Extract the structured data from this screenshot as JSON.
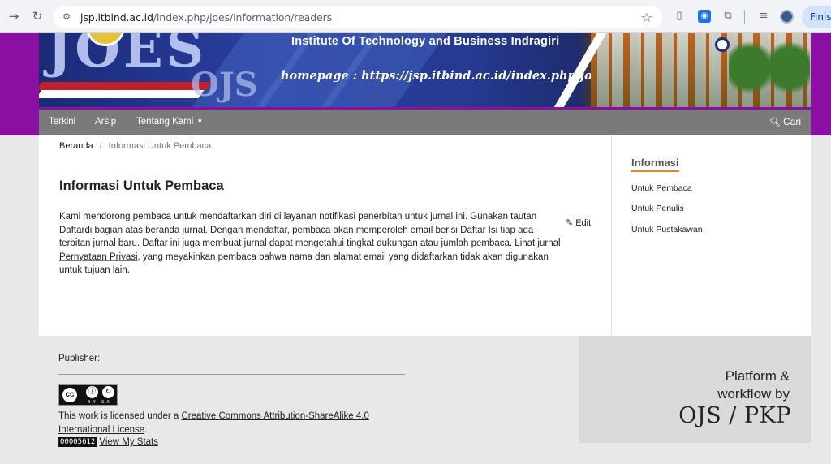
{
  "browser": {
    "url_domain": "jsp.itbind.ac.id",
    "url_path": "/index.php/joes/information/readers",
    "finish_label": "Finish"
  },
  "banner": {
    "institute": "Institute Of  Technology and  Business Indragiri",
    "homepage": "homepage : https://jsp.itbind.ac.id/index.php/joes",
    "logo_text": "JOES",
    "ojs_text": "OJS"
  },
  "nav": {
    "items": [
      "Terkini",
      "Arsip",
      "Tentang Kami"
    ],
    "search_label": "Cari"
  },
  "breadcrumb": {
    "home": "Beranda",
    "separator": "/",
    "current": "Informasi Untuk Pembaca"
  },
  "main": {
    "title": "Informasi Untuk Pembaca",
    "edit_label": "Edit",
    "para_1": "Kami mendorong pembaca untuk mendaftarkan diri di layanan notifikasi penerbitan untuk jurnal ini. Gunakan tautan ",
    "link_daftar": "Daftar",
    "para_2": "di bagian atas beranda jurnal. Dengan mendaftar, pembaca akan memperoleh email berisi Daftar Isi tiap ada terbitan jurnal baru. Daftar ini juga membuat jurnal dapat mengetahui tingkat dukungan atau jumlah pembaca. Lihat jurnal ",
    "link_privacy": "Pernyataan Privasi",
    "para_3": ", yang meyakinkan pembaca bahwa nama dan alamat email yang didaftarkan tidak akan digunakan untuk tujuan lain."
  },
  "sidebar": {
    "title": "Informasi",
    "links": [
      "Untuk Pembaca",
      "Untuk Penulis",
      "Untuk Pustakawan"
    ]
  },
  "footer": {
    "publisher_label": "Publisher:",
    "cc_by": "BY",
    "cc_sa": "SA",
    "license_prefix": "This work is licensed under a ",
    "license_link": "Creative Commons Attribution-ShareAlike 4.0 International License",
    "license_suffix": ".",
    "counter": "00005612",
    "stats_link": "View My Stats",
    "platform_line1": "Platform &",
    "platform_line2": "workflow by",
    "pkp_logo": "OJS / PKP"
  },
  "colors": {
    "purple_band": "#8b0fa3",
    "navbar": "#7a7a7a",
    "sidebar_accent": "#e08a1e"
  }
}
